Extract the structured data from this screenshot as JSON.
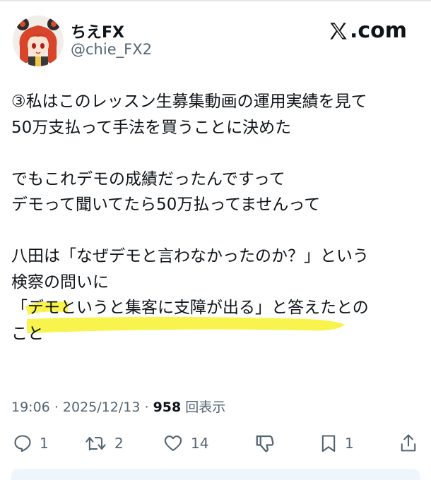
{
  "author": {
    "display_name": "ちえFX",
    "handle": "@chie_FX2"
  },
  "brand": {
    "label": ".com",
    "icon": "x-logo-icon"
  },
  "post": {
    "lines": [
      "③私はこのレッスン生募集動画の運用実績を見て",
      "50万支払って手法を買うことに決めた",
      "",
      "でもこれデモの成績だったんですって",
      "デモって聞いてたら50万払ってませんって",
      "",
      "八田は「なぜデモと言わなかったのか？」という",
      "検察の問いに",
      "「デモというと集客に支障が出る」と答えたとの",
      "こと"
    ],
    "highlight_color": "#f7f23a"
  },
  "meta": {
    "time": "19:06",
    "separator": "·",
    "date": "2025/12/13",
    "views": "958",
    "views_label": "回表示"
  },
  "actions": {
    "reply": {
      "icon": "reply-icon",
      "count": "1"
    },
    "repost": {
      "icon": "repost-icon",
      "count": "2"
    },
    "like": {
      "icon": "heart-icon",
      "count": "14"
    },
    "dislike": {
      "icon": "thumbs-down-icon",
      "count": ""
    },
    "bookmark": {
      "icon": "bookmark-icon",
      "count": "1"
    },
    "share": {
      "icon": "share-icon",
      "count": ""
    }
  },
  "colors": {
    "text": "#0f1419",
    "secondary": "#536471",
    "highlight": "#f7f23a"
  }
}
